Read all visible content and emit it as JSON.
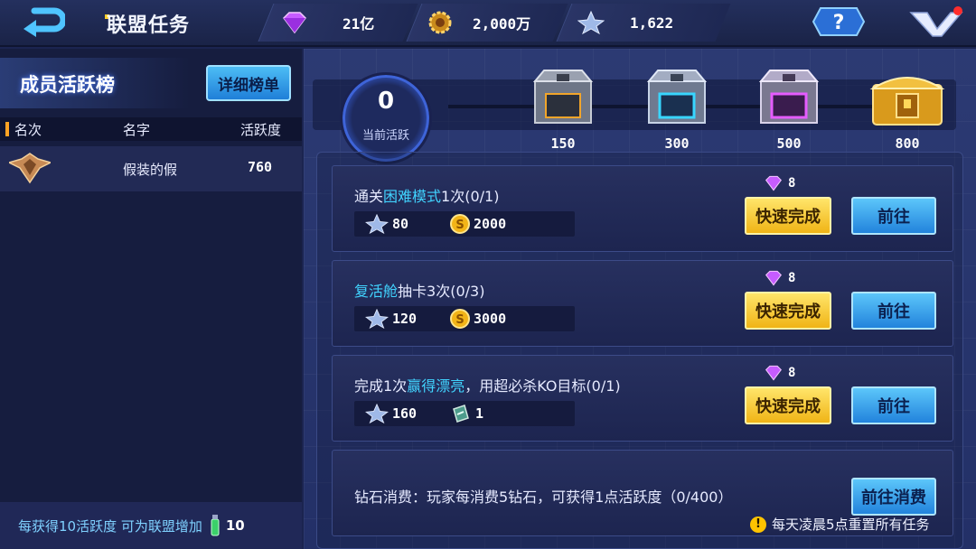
{
  "header": {
    "title": "联盟任务",
    "resources": [
      {
        "icon": "purple-diamond-icon",
        "value": "21亿"
      },
      {
        "icon": "gold-gear-coin-icon",
        "value": "2,000万"
      },
      {
        "icon": "blue-star-token-icon",
        "value": "1,622"
      }
    ],
    "help": "?"
  },
  "left_panel": {
    "title": "成员活跃榜",
    "detail_button": "详细榜单",
    "columns": [
      "名次",
      "名字",
      "活跃度"
    ],
    "rows": [
      {
        "name": "假装的假",
        "score": "760"
      }
    ],
    "footer_text": "每获得10活跃度  可为联盟增加",
    "footer_value": "10"
  },
  "progress": {
    "current_value": "0",
    "current_label": "当前活跃",
    "chests": [
      {
        "type": "gray",
        "value": "150"
      },
      {
        "type": "blue",
        "value": "300"
      },
      {
        "type": "purple",
        "value": "500"
      },
      {
        "type": "gold",
        "value": "800"
      }
    ]
  },
  "tasks": [
    {
      "text_before": "通关",
      "highlight": "困难模式",
      "text_after": "1次(0/1)",
      "reward_token": "80",
      "reward_second": "2000",
      "gem_cost": "8",
      "quick_label": "快速完成",
      "go_label": "前往"
    },
    {
      "text_before": "",
      "highlight": "复活舱",
      "text_after": "抽卡3次(0/3)",
      "reward_token": "120",
      "reward_second": "3000",
      "gem_cost": "8",
      "quick_label": "快速完成",
      "go_label": "前往"
    },
    {
      "text_before": "完成1次",
      "highlight": "赢得漂亮",
      "text_after": "，用超必杀KO目标(0/1)",
      "reward_token": "160",
      "reward_second": "1",
      "gem_cost": "8",
      "quick_label": "快速完成",
      "go_label": "前往"
    },
    {
      "text_before": "钻石消费：玩家每消费5钻石，可获得1点活跃度（0/400）",
      "highlight": "",
      "text_after": "",
      "go_label": "前往消费"
    }
  ],
  "bottom_note": "每天凌晨5点重置所有任务",
  "colors": {
    "highlight": "#41d4ff",
    "quick_button": "#f0b416",
    "go_button": "#2283dc"
  }
}
